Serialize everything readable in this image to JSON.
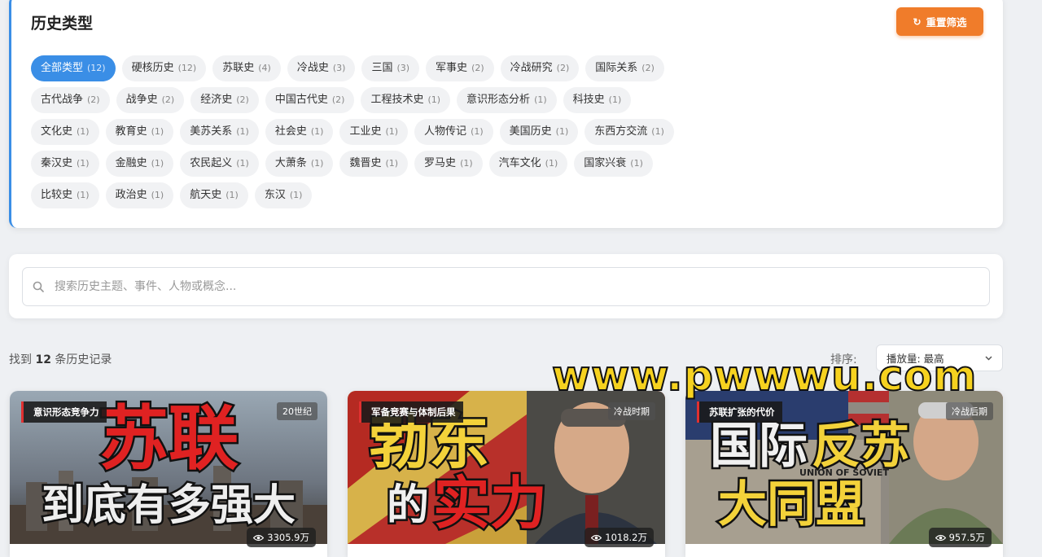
{
  "filter": {
    "title": "历史类型",
    "reset_label": "重置筛选",
    "tag_rows": [
      [
        {
          "label": "全部类型",
          "count": "(12)",
          "active": true
        },
        {
          "label": "硬核历史",
          "count": "(12)"
        },
        {
          "label": "苏联史",
          "count": "(4)"
        },
        {
          "label": "冷战史",
          "count": "(3)"
        },
        {
          "label": "三国",
          "count": "(3)"
        },
        {
          "label": "军事史",
          "count": "(2)"
        },
        {
          "label": "冷战研究",
          "count": "(2)"
        },
        {
          "label": "国际关系",
          "count": "(2)"
        }
      ],
      [
        {
          "label": "古代战争",
          "count": "(2)"
        },
        {
          "label": "战争史",
          "count": "(2)"
        },
        {
          "label": "经济史",
          "count": "(2)"
        },
        {
          "label": "中国古代史",
          "count": "(2)"
        },
        {
          "label": "工程技术史",
          "count": "(1)"
        },
        {
          "label": "意识形态分析",
          "count": "(1)"
        },
        {
          "label": "科技史",
          "count": "(1)"
        }
      ],
      [
        {
          "label": "文化史",
          "count": "(1)"
        },
        {
          "label": "教育史",
          "count": "(1)"
        },
        {
          "label": "美苏关系",
          "count": "(1)"
        },
        {
          "label": "社会史",
          "count": "(1)"
        },
        {
          "label": "工业史",
          "count": "(1)"
        },
        {
          "label": "人物传记",
          "count": "(1)"
        },
        {
          "label": "美国历史",
          "count": "(1)"
        },
        {
          "label": "东西方交流",
          "count": "(1)"
        }
      ],
      [
        {
          "label": "秦汉史",
          "count": "(1)"
        },
        {
          "label": "金融史",
          "count": "(1)"
        },
        {
          "label": "农民起义",
          "count": "(1)"
        },
        {
          "label": "大萧条",
          "count": "(1)"
        },
        {
          "label": "魏晋史",
          "count": "(1)"
        },
        {
          "label": "罗马史",
          "count": "(1)"
        },
        {
          "label": "汽车文化",
          "count": "(1)"
        },
        {
          "label": "国家兴衰",
          "count": "(1)"
        }
      ],
      [
        {
          "label": "比较史",
          "count": "(1)"
        },
        {
          "label": "政治史",
          "count": "(1)"
        },
        {
          "label": "航天史",
          "count": "(1)"
        },
        {
          "label": "东汉",
          "count": "(1)"
        }
      ]
    ]
  },
  "search": {
    "placeholder": "搜索历史主题、事件、人物或概念..."
  },
  "results": {
    "prefix": "找到",
    "count": "12",
    "suffix": "条历史记录"
  },
  "sort": {
    "label": "排序:",
    "selected": "播放量: 最高"
  },
  "watermark": "www.pwwwu.com",
  "cards": [
    {
      "category": "意识形态竞争力",
      "era": "20世纪",
      "views": "3305.9万",
      "thumb_lines": [
        "苏联",
        "到底有多强大"
      ]
    },
    {
      "category": "军备竞赛与体制后果",
      "era": "冷战时期",
      "views": "1018.2万",
      "thumb_lines": [
        "勃东",
        "的",
        "实力"
      ]
    },
    {
      "category": "苏联扩张的代价",
      "era": "冷战后期",
      "views": "957.5万",
      "thumb_lines": [
        "国际",
        "反苏",
        "大同盟",
        "UNION OF SOVIET"
      ]
    }
  ],
  "colors": {
    "accent": "#3a8ee6",
    "reset": "#f07c2a",
    "watermark": "#f6d21f"
  }
}
